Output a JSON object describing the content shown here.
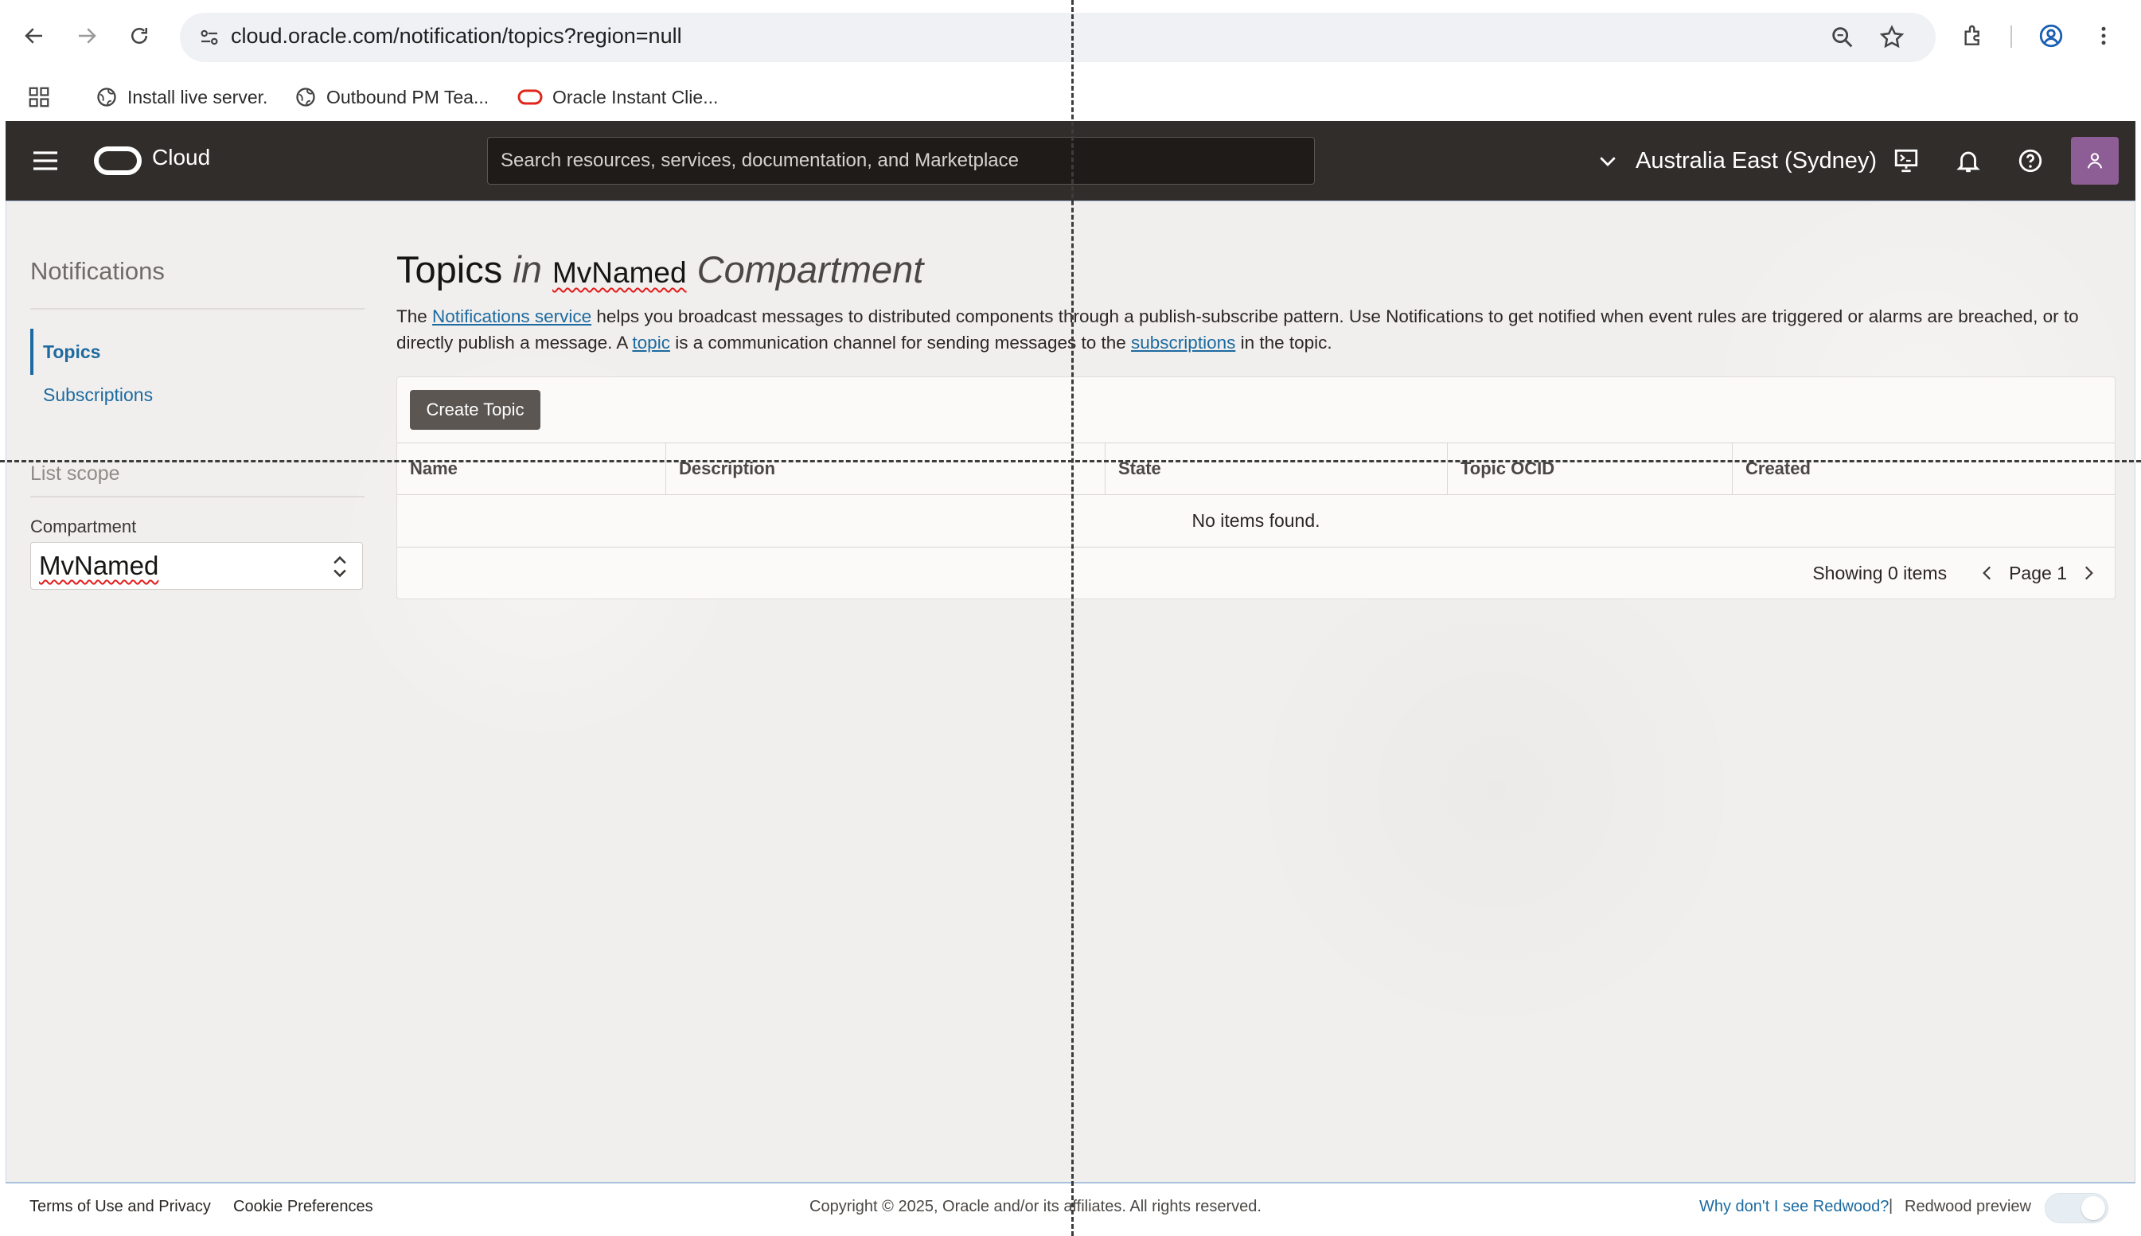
{
  "browser": {
    "url": "cloud.oracle.com/notification/topics?region=null",
    "bookmarks": [
      {
        "label": "Install live server.",
        "icon": "globe-icon"
      },
      {
        "label": "Outbound PM Tea...",
        "icon": "globe-icon"
      },
      {
        "label": "Oracle Instant Clie...",
        "icon": "oracle-logo-icon"
      }
    ]
  },
  "header": {
    "brand": "Cloud",
    "search_placeholder": "Search resources, services, documentation, and Marketplace",
    "region": "Australia East (Sydney)",
    "avatar_color": "#8d5d95",
    "header_color": "#312d2a"
  },
  "sidebar": {
    "title": "Notifications",
    "items": [
      {
        "label": "Topics",
        "active": true
      },
      {
        "label": "Subscriptions",
        "active": false
      }
    ],
    "list_scope_label": "List scope",
    "compartment_label": "Compartment",
    "compartment_value": "MvNamed"
  },
  "main": {
    "title_prefix": "Topics",
    "title_in": "in",
    "title_compartment": "MvNamed",
    "title_suffix": "Compartment",
    "description": {
      "part1": "The ",
      "link1": "Notifications service",
      "part2": " helps you broadcast messages to distributed components through a publish-subscribe pattern. Use Notifications to get notified when event rules are triggered or alarms are breached, or to directly publish a message. A ",
      "link2": "topic",
      "part3": " is a communication channel for sending messages to the ",
      "link3": "subscriptions",
      "part4": " in the topic."
    },
    "create_button": "Create Topic",
    "columns": [
      "Name",
      "Description",
      "State",
      "Topic OCID",
      "Created"
    ],
    "empty_text": "No items found.",
    "showing_text": "Showing 0 items",
    "page_text": "Page 1"
  },
  "footer": {
    "terms": "Terms of Use and Privacy",
    "cookies": "Cookie Preferences",
    "copyright": "Copyright © 2025, Oracle and/or its affiliates. All rights reserved.",
    "why_redwood": "Why don't I see Redwood?",
    "separator": "|",
    "redwood_preview": "Redwood preview"
  },
  "colors": {
    "link": "#1c6aa0",
    "button": "#5b5652",
    "content_bg": "#f1efed"
  }
}
